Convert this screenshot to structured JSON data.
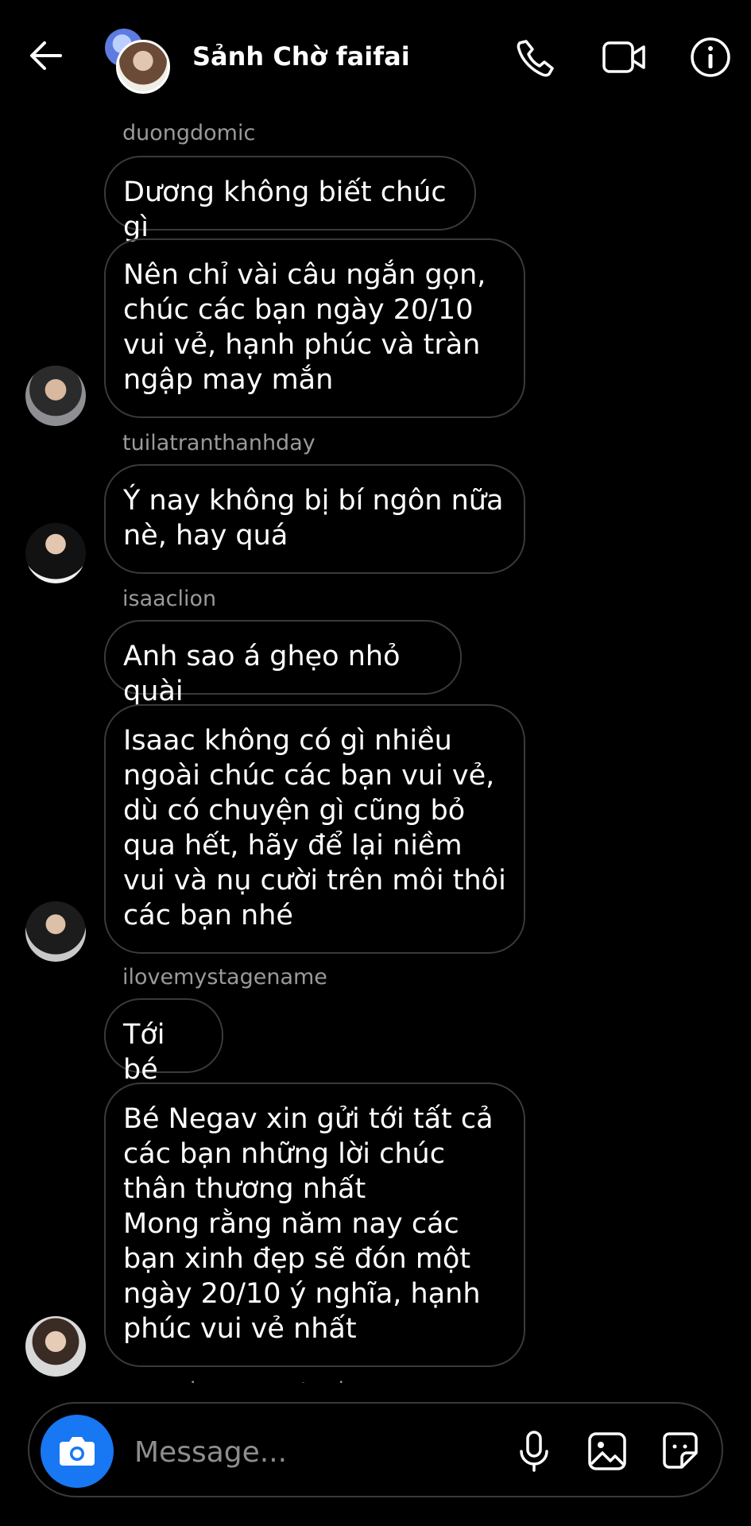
{
  "header": {
    "title": "Sảnh Chờ faifai",
    "icons": [
      "back-arrow-icon",
      "phone-icon",
      "video-camera-icon",
      "info-icon"
    ]
  },
  "messages": [
    {
      "sender": "duongdomic",
      "bubbles": [
        "Dương không biết chúc gì",
        "Nên chỉ vài câu ngắn gọn, chúc các bạn ngày 20/10 vui vẻ, hạnh phúc và tràn ngập may mắn"
      ]
    },
    {
      "sender": "tuilatranthanhday",
      "bubbles": [
        "Ý nay không bị bí ngôn nữa nè, hay quá"
      ]
    },
    {
      "sender": "isaaclion",
      "bubbles": [
        "Anh sao á ghẹo nhỏ quài",
        "Isaac không có gì nhiều ngoài chúc các bạn vui vẻ, dù có chuyện gì cũng bỏ qua hết, hãy để lại niềm vui và nụ cười trên môi thôi các bạn nhé"
      ]
    },
    {
      "sender": "ilovemystagename",
      "bubbles": [
        "Tới bé",
        "Bé Negav xin gửi tới tất cả các bạn những lời chúc thân thương nhất\nMong rằng năm nay các bạn xinh đẹp sẽ đón một ngày 20/10 ý nghĩa, hạnh phúc vui vẻ nhất"
      ]
    },
    {
      "sender": "quanghung_masterd",
      "bubbles": []
    }
  ],
  "composer": {
    "placeholder": "Message...",
    "icons": [
      "camera-icon",
      "microphone-icon",
      "gallery-icon",
      "sticker-icon"
    ]
  },
  "colors": {
    "accent": "#1877f2",
    "background": "#000000",
    "bubble_border": "#3a3a3a",
    "username": "#9a9a9a"
  }
}
